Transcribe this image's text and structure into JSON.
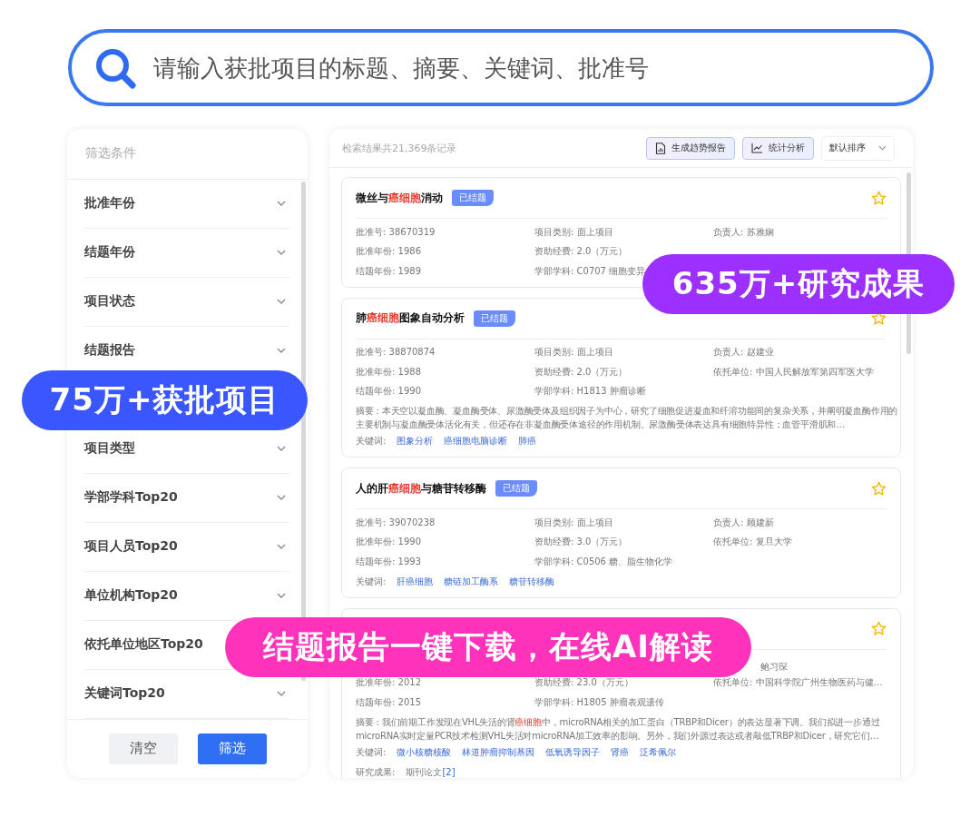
{
  "search": {
    "placeholder": "请输入获批项目的标题、摘要、关键词、批准号"
  },
  "filter": {
    "title": "筛选条件",
    "items": [
      {
        "label": "批准年份",
        "expanded": false
      },
      {
        "label": "结题年份",
        "expanded": false
      },
      {
        "label": "项目状态",
        "expanded": false
      },
      {
        "label": "结题报告",
        "expanded": false
      },
      {
        "label": "项目类型",
        "expanded": false
      },
      {
        "label": "学部学科Top20",
        "expanded": false
      },
      {
        "label": "项目人员Top20",
        "expanded": false
      },
      {
        "label": "单位机构Top20",
        "expanded": false
      },
      {
        "label": "依托单位地区Top20"
      },
      {
        "label": "关键词Top20",
        "expanded": false
      }
    ],
    "buttons": [
      {
        "label": "清空",
        "kind": "secondary"
      },
      {
        "label": "筛选",
        "kind": "primary"
      }
    ]
  },
  "results": {
    "summary": "检索结果共21,369条记录",
    "actions": [
      {
        "label": "生成趋势报告",
        "kind": "report"
      },
      {
        "label": "统计分析",
        "kind": "chart"
      }
    ],
    "sort": "默认排序",
    "cards": [
      {
        "title": [
          {
            "text": "微丝与"
          },
          {
            "text": "癌细胞",
            "highlight": true
          },
          {
            "text": "消动"
          }
        ],
        "status": "已结题",
        "starred": false,
        "fields": [
          {
            "a": "批准号: 38670319",
            "b": "项目类别: 面上项目",
            "c": "负责人: 苏雅娴"
          },
          {
            "a": "批准年份: 1986",
            "b": "资助经费: 2.0（万元）"
          },
          {
            "a": "结题年份: 1989",
            "b": "学部学科: C0707 细胞变异"
          }
        ]
      },
      {
        "title": [
          {
            "text": "肺"
          },
          {
            "text": "癌细胞",
            "highlight": true
          },
          {
            "text": "图象自动分析"
          }
        ],
        "status": "已结题",
        "starred": false,
        "fields": [
          {
            "a": "批准号: 38870874",
            "b": "项目类别: 面上项目",
            "c": "负责人: 赵建业"
          },
          {
            "a": "批准年份: 1988",
            "b": "资助经费: 2.0（万元）",
            "c": "依托单位: 中国人民解放军第四军医大学"
          },
          {
            "a": "结题年份: 1990",
            "b": "学部学科: H1813 肿瘤诊断"
          }
        ],
        "abstract": [
          {
            "text": "摘要 : 本天空以凝血酶、凝血酶受体、尿激酶受体及组织因子为中心，研究了细胞促进凝血和纤溶功能间的复杂关系，并阐明凝血酶作用的主要机制与凝血酶受体活化有关，但还存在非凝血酶受体途径的作用机制。尿激酶受体表达具有细胞特异性；血管平滑肌和…"
          }
        ],
        "keywords_label": "关键词:",
        "keywords": [
          "图象分析",
          "癌细胞电脑诊断",
          "肺癌"
        ]
      },
      {
        "title": [
          {
            "text": "人的肝"
          },
          {
            "text": "癌细胞",
            "highlight": true
          },
          {
            "text": "与糖苷转移酶"
          }
        ],
        "status": "已结题",
        "starred": false,
        "fields": [
          {
            "a": "批准号: 39070238",
            "b": "项目类别: 面上项目",
            "c": "负责人: 顾建新"
          },
          {
            "a": "批准年份: 1990",
            "b": "资助经费: 3.0（万元）",
            "c": "依托单位: 复旦大学"
          },
          {
            "a": "结题年份: 1993",
            "b": "学部学科: C0506 糖、脂生物化学"
          }
        ],
        "keywords_label": "关键词:",
        "keywords": [
          "肝癌细胞",
          "糖链加工酶系",
          "糖苷转移酶"
        ]
      },
      {
        "starred": false,
        "fields": [
          {
            "c": "鲍习琛"
          },
          {
            "a": "批准年份: 2012",
            "b": "资助经费: 23.0（万元）",
            "c": "依托单位: 中国科学院广州生物医药与健…"
          },
          {
            "a": "结题年份: 2015",
            "b": "学部学科: H1805 肿瘤表观遗传"
          }
        ],
        "abstract": [
          {
            "text": "摘要 : 我们前期工作发现在VHL失活的肾"
          },
          {
            "text": "癌细胞",
            "highlight": true
          },
          {
            "text": "中，microRNA相关的加工蛋白（TRBP和Dicer）的表达显著下调。我们拟进一步通过microRNA实时定量PCR技术检测VHL失活对microRNA加工效率的影响。另外，我们外源过表达或者敲低TRBP和Dicer，研究它们…"
          }
        ],
        "keywords_label": "关键词:",
        "keywords": [
          "微小核糖核酸",
          "林道肿瘤抑制基因",
          "低氧诱导因子",
          "肾癌",
          "泛希佩尔"
        ],
        "outputs_label": "研究成果:",
        "outputs": [
          {
            "text": "期刊论文"
          },
          {
            "text": "[2]",
            "link": true
          }
        ]
      }
    ]
  },
  "banners": [
    {
      "text": "635万+研究成果",
      "color": "#9b30ff"
    },
    {
      "text": "75万+获批项目",
      "color": "#3a56ff"
    },
    {
      "text": "结题报告一键下载，在线AI解读",
      "color": "#ff33bb"
    }
  ]
}
